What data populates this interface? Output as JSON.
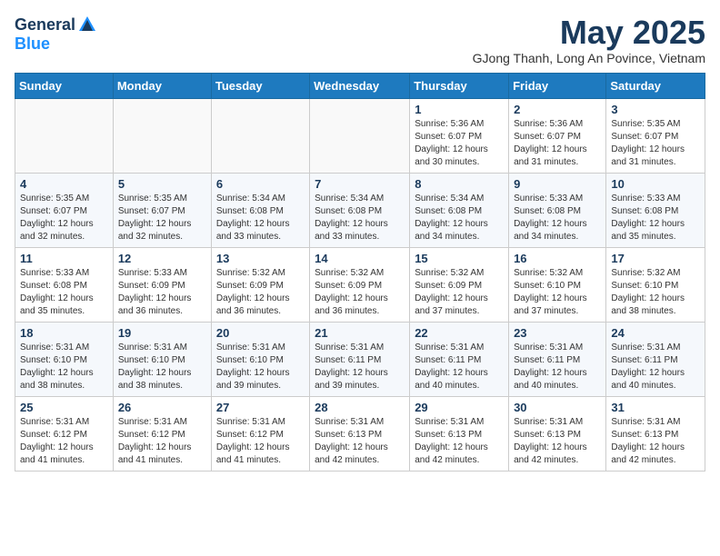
{
  "logo": {
    "general": "General",
    "blue": "Blue"
  },
  "title": {
    "month": "May 2025",
    "location": "GJong Thanh, Long An Povince, Vietnam"
  },
  "headers": [
    "Sunday",
    "Monday",
    "Tuesday",
    "Wednesday",
    "Thursday",
    "Friday",
    "Saturday"
  ],
  "weeks": [
    [
      {
        "day": "",
        "info": ""
      },
      {
        "day": "",
        "info": ""
      },
      {
        "day": "",
        "info": ""
      },
      {
        "day": "",
        "info": ""
      },
      {
        "day": "1",
        "info": "Sunrise: 5:36 AM\nSunset: 6:07 PM\nDaylight: 12 hours\nand 30 minutes."
      },
      {
        "day": "2",
        "info": "Sunrise: 5:36 AM\nSunset: 6:07 PM\nDaylight: 12 hours\nand 31 minutes."
      },
      {
        "day": "3",
        "info": "Sunrise: 5:35 AM\nSunset: 6:07 PM\nDaylight: 12 hours\nand 31 minutes."
      }
    ],
    [
      {
        "day": "4",
        "info": "Sunrise: 5:35 AM\nSunset: 6:07 PM\nDaylight: 12 hours\nand 32 minutes."
      },
      {
        "day": "5",
        "info": "Sunrise: 5:35 AM\nSunset: 6:07 PM\nDaylight: 12 hours\nand 32 minutes."
      },
      {
        "day": "6",
        "info": "Sunrise: 5:34 AM\nSunset: 6:08 PM\nDaylight: 12 hours\nand 33 minutes."
      },
      {
        "day": "7",
        "info": "Sunrise: 5:34 AM\nSunset: 6:08 PM\nDaylight: 12 hours\nand 33 minutes."
      },
      {
        "day": "8",
        "info": "Sunrise: 5:34 AM\nSunset: 6:08 PM\nDaylight: 12 hours\nand 34 minutes."
      },
      {
        "day": "9",
        "info": "Sunrise: 5:33 AM\nSunset: 6:08 PM\nDaylight: 12 hours\nand 34 minutes."
      },
      {
        "day": "10",
        "info": "Sunrise: 5:33 AM\nSunset: 6:08 PM\nDaylight: 12 hours\nand 35 minutes."
      }
    ],
    [
      {
        "day": "11",
        "info": "Sunrise: 5:33 AM\nSunset: 6:08 PM\nDaylight: 12 hours\nand 35 minutes."
      },
      {
        "day": "12",
        "info": "Sunrise: 5:33 AM\nSunset: 6:09 PM\nDaylight: 12 hours\nand 36 minutes."
      },
      {
        "day": "13",
        "info": "Sunrise: 5:32 AM\nSunset: 6:09 PM\nDaylight: 12 hours\nand 36 minutes."
      },
      {
        "day": "14",
        "info": "Sunrise: 5:32 AM\nSunset: 6:09 PM\nDaylight: 12 hours\nand 36 minutes."
      },
      {
        "day": "15",
        "info": "Sunrise: 5:32 AM\nSunset: 6:09 PM\nDaylight: 12 hours\nand 37 minutes."
      },
      {
        "day": "16",
        "info": "Sunrise: 5:32 AM\nSunset: 6:10 PM\nDaylight: 12 hours\nand 37 minutes."
      },
      {
        "day": "17",
        "info": "Sunrise: 5:32 AM\nSunset: 6:10 PM\nDaylight: 12 hours\nand 38 minutes."
      }
    ],
    [
      {
        "day": "18",
        "info": "Sunrise: 5:31 AM\nSunset: 6:10 PM\nDaylight: 12 hours\nand 38 minutes."
      },
      {
        "day": "19",
        "info": "Sunrise: 5:31 AM\nSunset: 6:10 PM\nDaylight: 12 hours\nand 38 minutes."
      },
      {
        "day": "20",
        "info": "Sunrise: 5:31 AM\nSunset: 6:10 PM\nDaylight: 12 hours\nand 39 minutes."
      },
      {
        "day": "21",
        "info": "Sunrise: 5:31 AM\nSunset: 6:11 PM\nDaylight: 12 hours\nand 39 minutes."
      },
      {
        "day": "22",
        "info": "Sunrise: 5:31 AM\nSunset: 6:11 PM\nDaylight: 12 hours\nand 40 minutes."
      },
      {
        "day": "23",
        "info": "Sunrise: 5:31 AM\nSunset: 6:11 PM\nDaylight: 12 hours\nand 40 minutes."
      },
      {
        "day": "24",
        "info": "Sunrise: 5:31 AM\nSunset: 6:11 PM\nDaylight: 12 hours\nand 40 minutes."
      }
    ],
    [
      {
        "day": "25",
        "info": "Sunrise: 5:31 AM\nSunset: 6:12 PM\nDaylight: 12 hours\nand 41 minutes."
      },
      {
        "day": "26",
        "info": "Sunrise: 5:31 AM\nSunset: 6:12 PM\nDaylight: 12 hours\nand 41 minutes."
      },
      {
        "day": "27",
        "info": "Sunrise: 5:31 AM\nSunset: 6:12 PM\nDaylight: 12 hours\nand 41 minutes."
      },
      {
        "day": "28",
        "info": "Sunrise: 5:31 AM\nSunset: 6:13 PM\nDaylight: 12 hours\nand 42 minutes."
      },
      {
        "day": "29",
        "info": "Sunrise: 5:31 AM\nSunset: 6:13 PM\nDaylight: 12 hours\nand 42 minutes."
      },
      {
        "day": "30",
        "info": "Sunrise: 5:31 AM\nSunset: 6:13 PM\nDaylight: 12 hours\nand 42 minutes."
      },
      {
        "day": "31",
        "info": "Sunrise: 5:31 AM\nSunset: 6:13 PM\nDaylight: 12 hours\nand 42 minutes."
      }
    ]
  ]
}
